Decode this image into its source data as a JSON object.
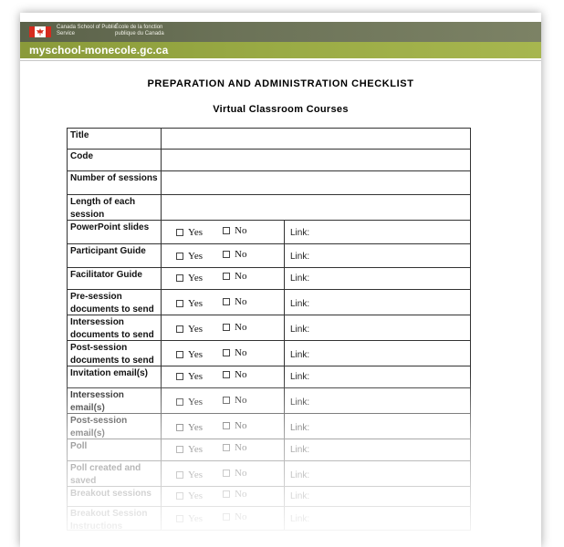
{
  "header": {
    "school_name_en": "Canada School of Public Service",
    "school_name_fr": "École de la fonction publique du Canada",
    "site_url": "myschool-monecole.gc.ca",
    "colors": {
      "banner_dark": "#5a6149",
      "banner_green": "#9aab45",
      "flag_red": "#d52b1e"
    }
  },
  "document": {
    "title": "PREPARATION AND ADMINISTRATION CHECKLIST",
    "subtitle": "Virtual Classroom Courses"
  },
  "checklist": {
    "yes_label": "Yes",
    "no_label": "No",
    "link_label": "Link:",
    "text_rows": [
      {
        "label": "Title"
      },
      {
        "label": "Code"
      },
      {
        "label": "Number of sessions"
      },
      {
        "label": "Length of each session"
      }
    ],
    "option_rows": [
      {
        "label": "PowerPoint slides"
      },
      {
        "label": "Participant Guide"
      },
      {
        "label": "Facilitator Guide"
      },
      {
        "label": "Pre-session documents to send"
      },
      {
        "label": "Intersession documents to send"
      },
      {
        "label": "Post-session documents to send"
      },
      {
        "label": "Invitation email(s)"
      },
      {
        "label": "Intersession email(s)"
      },
      {
        "label": "Post-session email(s)"
      },
      {
        "label": "Poll"
      },
      {
        "label": "Poll created and saved"
      },
      {
        "label": "Breakout sessions"
      },
      {
        "label": "Breakout Session Instructions"
      }
    ]
  }
}
